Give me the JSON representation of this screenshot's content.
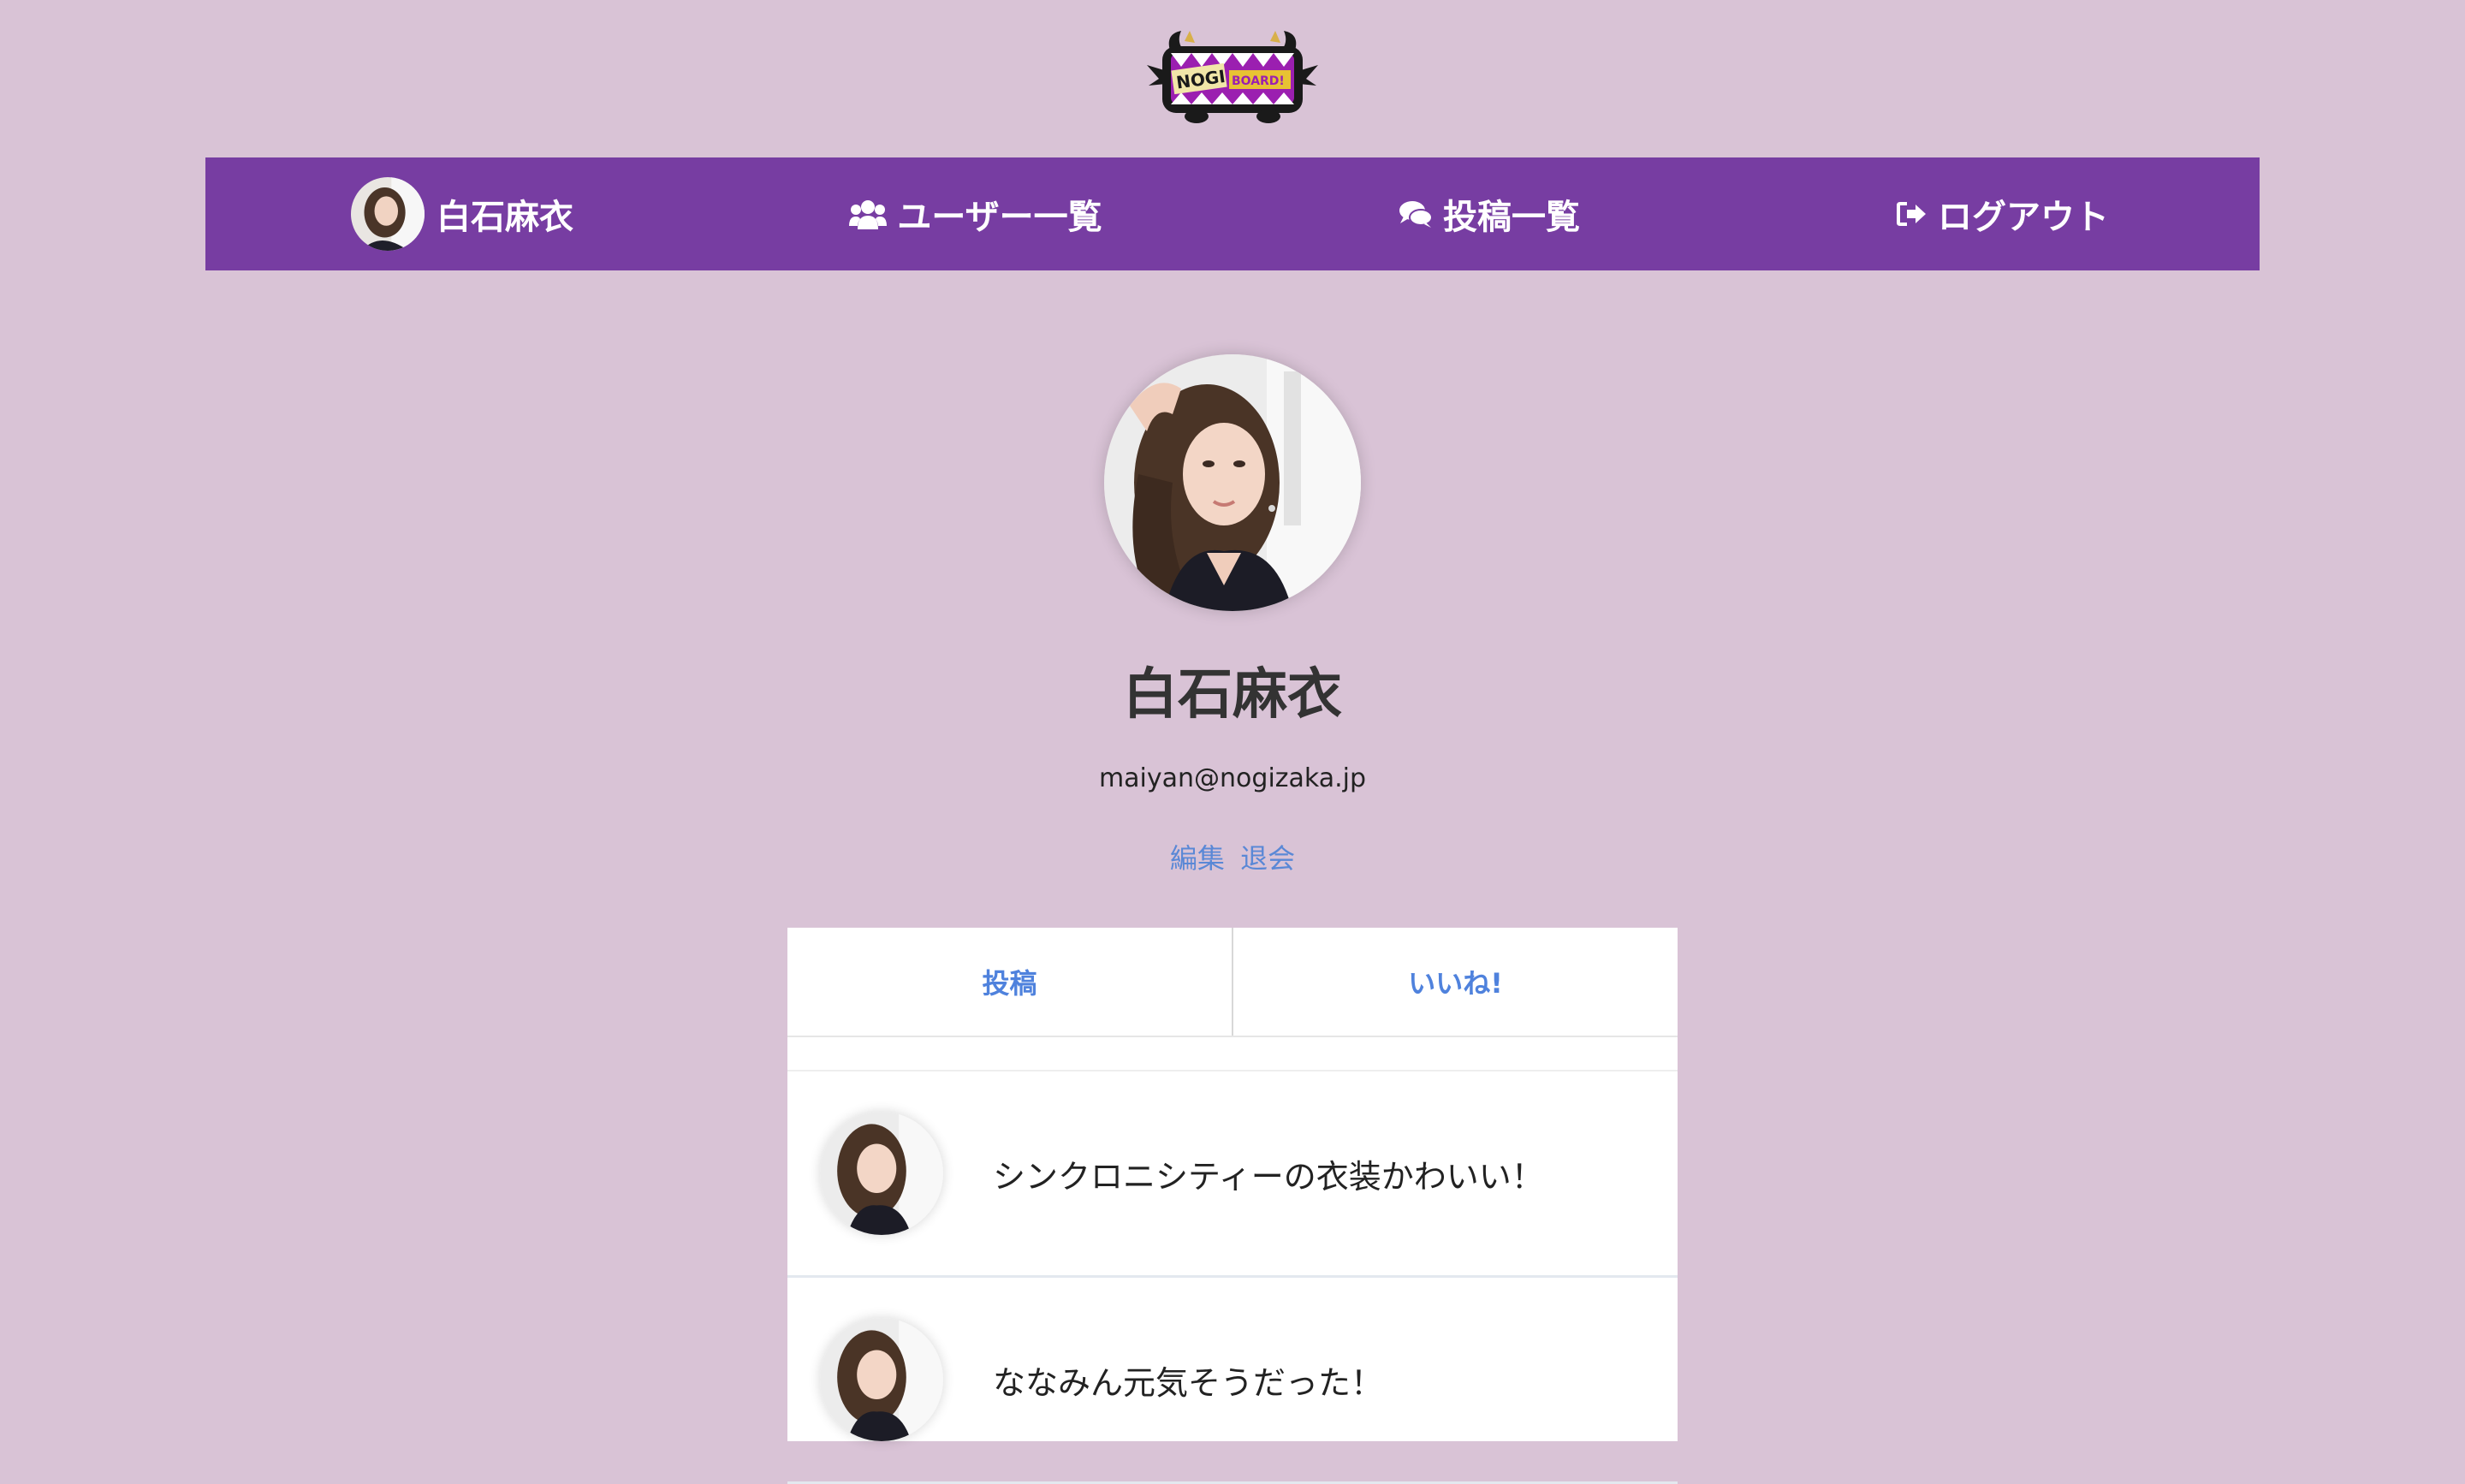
{
  "logo": {
    "text_left": "NOGI",
    "text_right": "BOARD!"
  },
  "nav": {
    "user_name": "白石麻衣",
    "users_label": "ユーザー一覧",
    "posts_label": "投稿一覧",
    "logout_label": "ログアウト"
  },
  "profile": {
    "name": "白石麻衣",
    "email": "maiyan@nogizaka.jp",
    "edit_label": "編集",
    "withdraw_label": "退会"
  },
  "tabs": {
    "posts_label": "投稿",
    "likes_label": "いいね!"
  },
  "posts": [
    {
      "text": "シンクロニシティーの衣装かわいい！"
    },
    {
      "text": "ななみん元気そうだった！"
    }
  ],
  "colors": {
    "background": "#d9c3d6",
    "navbar": "#773da2",
    "link": "#5a88d6"
  }
}
